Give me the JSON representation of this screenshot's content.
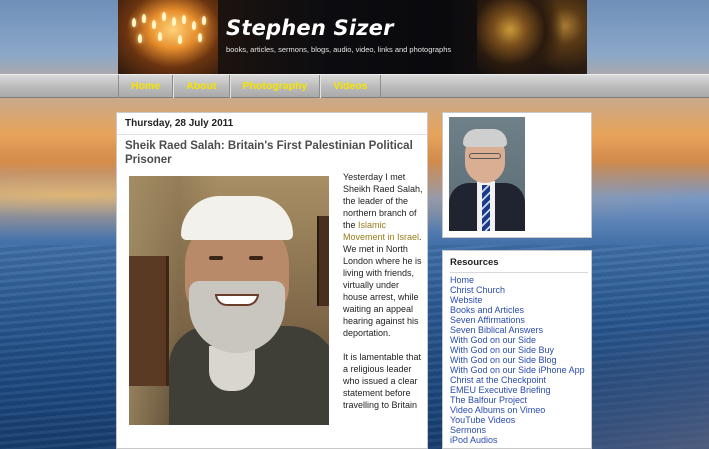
{
  "header": {
    "title": "Stephen Sizer",
    "tagline": "books, articles, sermons, blogs, audio, video, links and photographs"
  },
  "nav": {
    "items": [
      {
        "label": "Home"
      },
      {
        "label": "About"
      },
      {
        "label": "Photography"
      },
      {
        "label": "Videos"
      }
    ]
  },
  "post": {
    "date": "Thursday, 28 July 2011",
    "title": "Sheik Raed Salah: Britain's First Palestinian Political Prisoner",
    "para1_before": "Yesterday I met Sheikh Raed Salah, the leader of the northern branch of the ",
    "para1_link": "Islamic Movement in Israel",
    "para1_after": ". We met in North London where he is living with friends, virtually under house arrest, while waiting an appeal hearing against his deportation.",
    "para2": "It is lamentable that a religious leader who issued a clear statement before travelling to Britain"
  },
  "sidebar": {
    "resources_title": "Resources",
    "resources": [
      "Home",
      "Christ Church",
      "Website",
      "Books and Articles",
      "Seven Affirmations",
      "Seven Biblical Answers",
      "With God on our Side",
      "With God on our Side Buy",
      "With God on our Side Blog",
      "With God on our Side iPhone App",
      "Christ at the Checkpoint",
      "EMEU Executive Briefing",
      "The Balfour Project",
      "Video Albums on Vimeo",
      "YouTube Videos",
      "Sermons",
      "iPod Audios"
    ]
  },
  "colors": {
    "nav_text": "#f6e400",
    "link": "#2a4cb0",
    "post_link": "#9a7d1c"
  }
}
